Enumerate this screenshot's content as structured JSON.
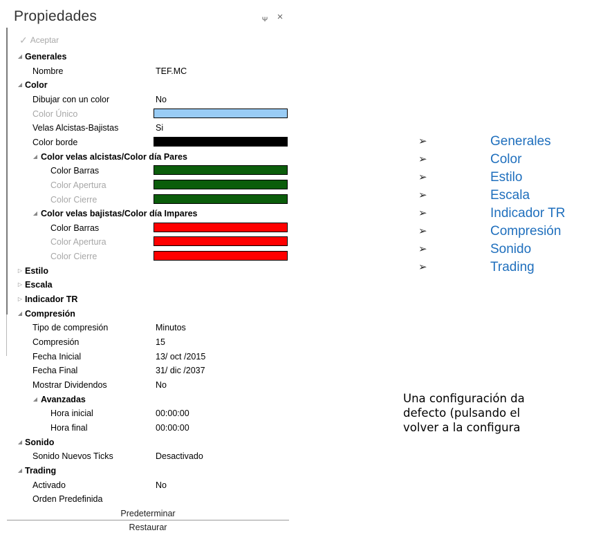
{
  "panel": {
    "title": "Propiedades",
    "pin_glyph": "ᴪ",
    "close_glyph": "×",
    "accept_label": "Aceptar",
    "footer_default": "Predeterminar",
    "footer_restore": "Restaurar"
  },
  "rows": [
    {
      "type": "section",
      "expanded": true,
      "label": "Generales"
    },
    {
      "type": "prop",
      "label": "Nombre",
      "value": "TEF.MC"
    },
    {
      "type": "section",
      "expanded": true,
      "label": "Color"
    },
    {
      "type": "prop",
      "label": "Dibujar con un color",
      "value": "No"
    },
    {
      "type": "color",
      "label": "Color Único",
      "dim": true,
      "color": "#99ccf5"
    },
    {
      "type": "prop",
      "label": "Velas Alcistas-Bajistas",
      "value": "Si"
    },
    {
      "type": "color",
      "label": "Color borde",
      "color": "#000000"
    },
    {
      "type": "subsection",
      "expanded": true,
      "label": "Color velas alcistas/Color día Pares"
    },
    {
      "type": "color",
      "label": "Color Barras",
      "indent": true,
      "color": "#0b5d0b"
    },
    {
      "type": "color",
      "label": "Color Apertura",
      "indent": true,
      "dim": true,
      "color": "#0b5d0b"
    },
    {
      "type": "color",
      "label": "Color Cierre",
      "indent": true,
      "dim": true,
      "color": "#0b5d0b"
    },
    {
      "type": "subsection",
      "expanded": true,
      "label": "Color velas bajistas/Color día Impares"
    },
    {
      "type": "color",
      "label": "Color Barras",
      "indent": true,
      "color": "#ff0000"
    },
    {
      "type": "color",
      "label": "Color Apertura",
      "indent": true,
      "dim": true,
      "color": "#ff0000"
    },
    {
      "type": "color",
      "label": "Color Cierre",
      "indent": true,
      "dim": true,
      "color": "#ff0000"
    },
    {
      "type": "section",
      "expanded": false,
      "label": "Estilo"
    },
    {
      "type": "section",
      "expanded": false,
      "label": "Escala"
    },
    {
      "type": "section",
      "expanded": false,
      "label": "Indicador TR"
    },
    {
      "type": "section",
      "expanded": true,
      "label": "Compresión"
    },
    {
      "type": "prop",
      "label": "Tipo de compresión",
      "value": "Minutos"
    },
    {
      "type": "prop",
      "label": "Compresión",
      "value": "15"
    },
    {
      "type": "prop",
      "label": "Fecha Inicial",
      "value": "13/ oct /2015"
    },
    {
      "type": "prop",
      "label": "Fecha Final",
      "value": "31/ dic /2037"
    },
    {
      "type": "prop",
      "label": "Mostrar Dividendos",
      "value": "No"
    },
    {
      "type": "subsection",
      "expanded": true,
      "label": "Avanzadas"
    },
    {
      "type": "prop",
      "label": "Hora inicial",
      "indent": true,
      "value": "00:00:00"
    },
    {
      "type": "prop",
      "label": "Hora final",
      "indent": true,
      "value": "00:00:00"
    },
    {
      "type": "section",
      "expanded": true,
      "label": "Sonido"
    },
    {
      "type": "prop",
      "label": "Sonido Nuevos Ticks",
      "value": "Desactivado"
    },
    {
      "type": "section",
      "expanded": true,
      "label": "Trading"
    },
    {
      "type": "prop",
      "label": "Activado",
      "value": "No"
    },
    {
      "type": "prop",
      "label": "Orden Predefinida",
      "value": ""
    }
  ],
  "bullets": [
    "Generales",
    "Color",
    "Estilo",
    "Escala",
    "Indicador TR",
    "Compresión",
    "Sonido",
    "Trading"
  ],
  "bullet_glyph": "➢",
  "paragraph": [
    "Una configuración da",
    "defecto (pulsando el",
    "volver a la configura"
  ]
}
